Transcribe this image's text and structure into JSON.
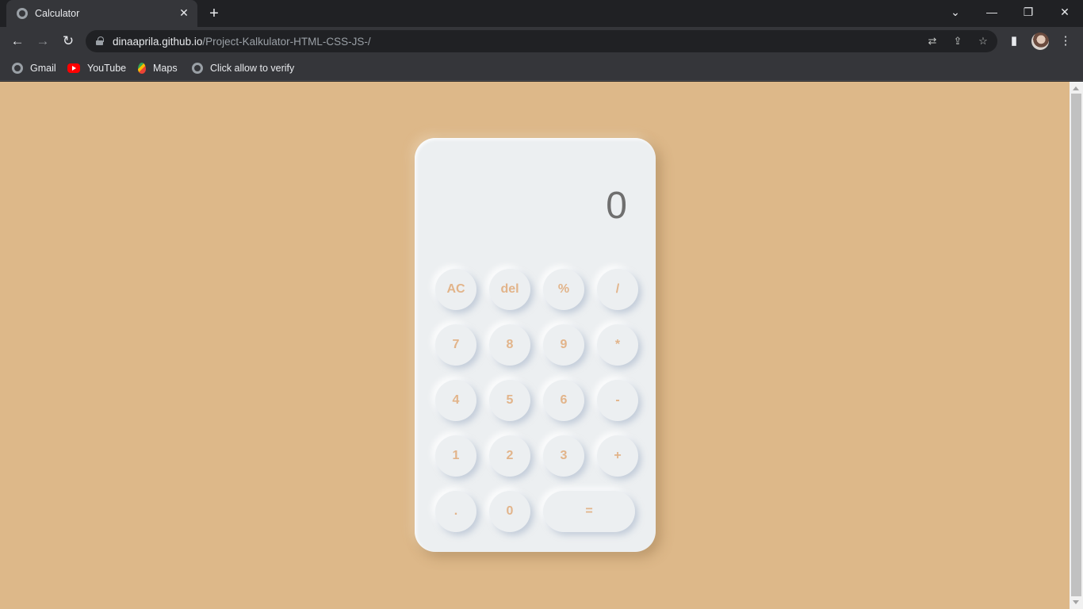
{
  "browser": {
    "tab": {
      "title": "Calculator",
      "favicon": "globe-icon"
    },
    "address_bar": {
      "host": "dinaaprila.github.io",
      "path": "/Project-Kalkulator-HTML-CSS-JS-/"
    },
    "bookmarks": [
      {
        "label": "Gmail",
        "icon": "globe-icon"
      },
      {
        "label": "YouTube",
        "icon": "youtube-icon"
      },
      {
        "label": "Maps",
        "icon": "maps-icon"
      },
      {
        "label": "Click allow to verify",
        "icon": "globe-icon"
      }
    ],
    "glyphs": {
      "close": "✕",
      "new_tab": "+",
      "tab_search": "⌄",
      "minimize": "—",
      "restore": "❐",
      "window_close": "✕",
      "back": "←",
      "forward": "→",
      "reload": "↻",
      "translate": "⇄",
      "share": "⇪",
      "star": "☆",
      "side_panel": "▮",
      "menu": "⋮"
    }
  },
  "page": {
    "background_color": "#ddb889",
    "key_text_color": "#e2b48a",
    "display_color": "#6f6f6f"
  },
  "calculator": {
    "display": "0",
    "keys": [
      "AC",
      "del",
      "%",
      "/",
      "7",
      "8",
      "9",
      "*",
      "4",
      "5",
      "6",
      "-",
      "1",
      "2",
      "3",
      "+",
      ".",
      "0",
      "="
    ]
  }
}
